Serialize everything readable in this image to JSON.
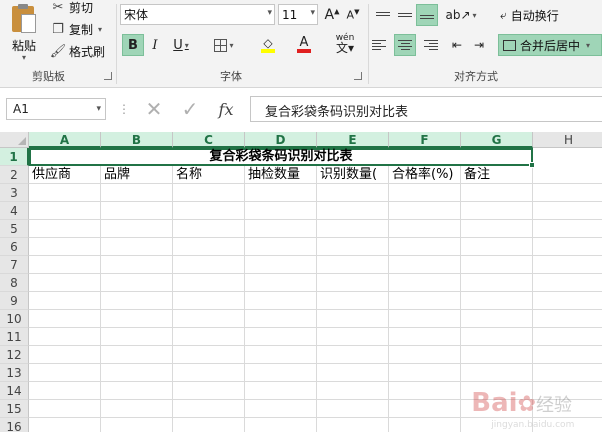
{
  "clipboard": {
    "paste_label": "粘贴",
    "cut_label": "剪切",
    "copy_label": "复制",
    "format_painter_label": "格式刷",
    "group_label": "剪贴板"
  },
  "font": {
    "font_name": "宋体",
    "font_size": "11",
    "bold_label": "B",
    "italic_label": "I",
    "underline_label": "U",
    "pinyin_label": "wén",
    "group_label": "字体",
    "highlight_color": "#ffff00",
    "font_color": "#e02020"
  },
  "alignment": {
    "wrap_text_label": "自动换行",
    "merge_center_label": "合并后居中",
    "group_label": "对齐方式"
  },
  "formula_bar": {
    "name_box": "A1",
    "fx_label": "fx",
    "content": "复合彩袋条码识别对比表"
  },
  "sheet": {
    "columns": [
      "A",
      "B",
      "C",
      "D",
      "E",
      "F",
      "G",
      "H"
    ],
    "rows": [
      "1",
      "2",
      "3",
      "4",
      "5",
      "6",
      "7",
      "8",
      "9",
      "10",
      "11",
      "12",
      "13",
      "14",
      "15",
      "16"
    ],
    "title": "复合彩袋条码识别对比表",
    "headers": [
      "供应商",
      "品牌",
      "名称",
      "抽检数量",
      "识别数量(",
      "合格率(%)",
      "备注"
    ],
    "accent_color": "#217346"
  },
  "watermark": {
    "brand": "Bai",
    "text": "经验",
    "site": "jingyan.baidu.com"
  }
}
